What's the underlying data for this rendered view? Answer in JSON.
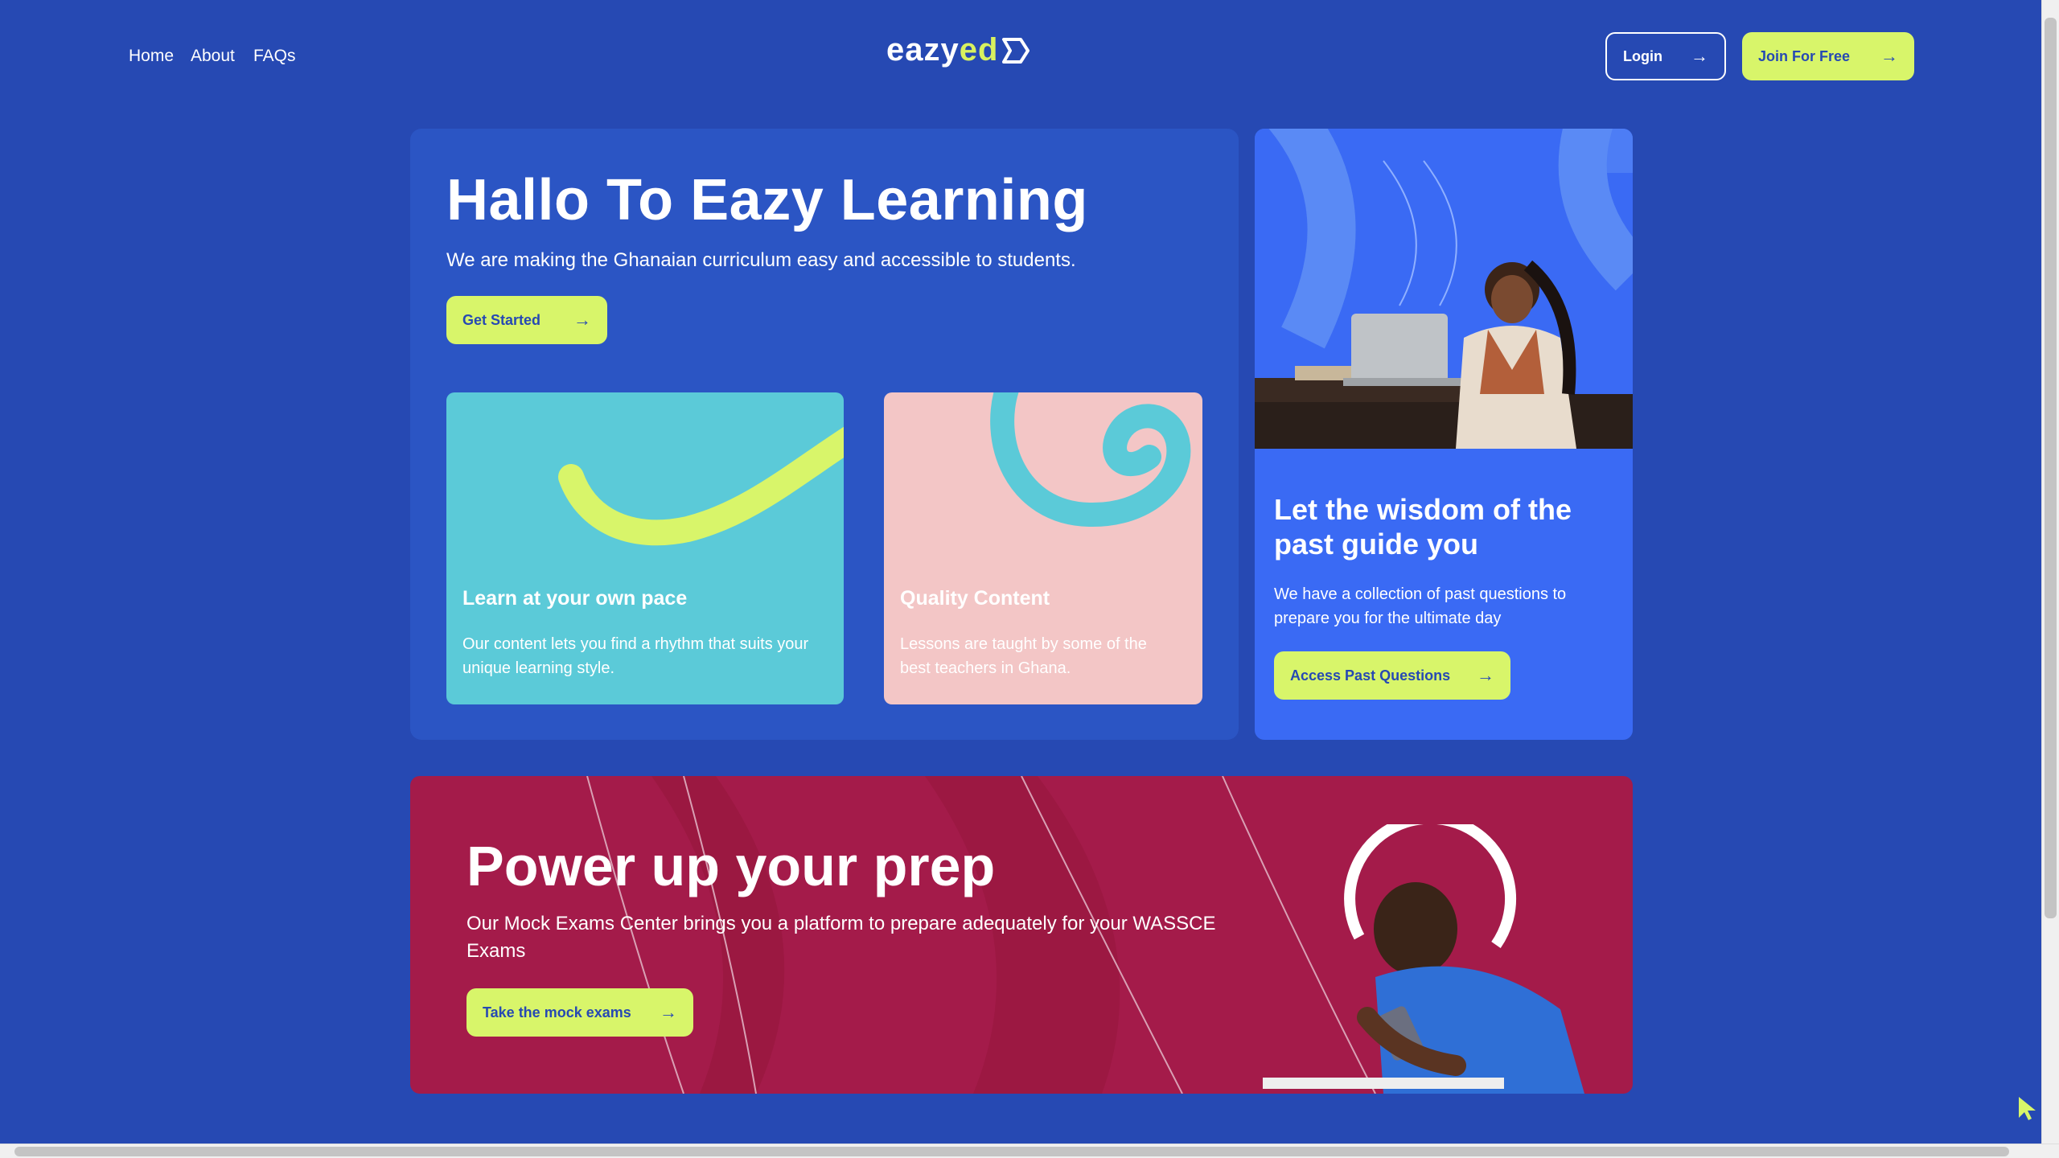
{
  "nav": {
    "home": "Home",
    "about": "About",
    "faqs": "FAQs"
  },
  "logo": {
    "part1": "eazy",
    "part2": "ed"
  },
  "header": {
    "login": "Login",
    "join": "Join For Free"
  },
  "hero": {
    "title": "Hallo To Eazy Learning",
    "subtitle": "We are making the Ghanaian curriculum easy and accessible to students.",
    "cta": "Get Started",
    "cards": [
      {
        "title": "Learn at your own pace",
        "body": "Our content lets you find a rhythm that suits your unique learning style.",
        "bg": "#5bcad8"
      },
      {
        "title": "Quality Content",
        "body": "Lessons are taught by some of the best teachers in Ghana.",
        "bg": "#f3c6c6"
      }
    ]
  },
  "side": {
    "title": "Let the wisdom of the past guide you",
    "body": "We have a collection of past questions to prepare you for the ultimate day",
    "cta": "Access Past Questions"
  },
  "banner": {
    "title": "Power up your prep",
    "body": "Our Mock Exams Center brings you a platform to prepare adequately for your WASSCE Exams",
    "cta": "Take the mock exams"
  },
  "colors": {
    "background": "#2649b3",
    "accent": "#d8f56a",
    "banner": "#a41b4a",
    "side": "#3a6af4"
  },
  "icons": {
    "arrow": "arrow-right-icon",
    "cursor": "mouse-cursor-icon"
  }
}
